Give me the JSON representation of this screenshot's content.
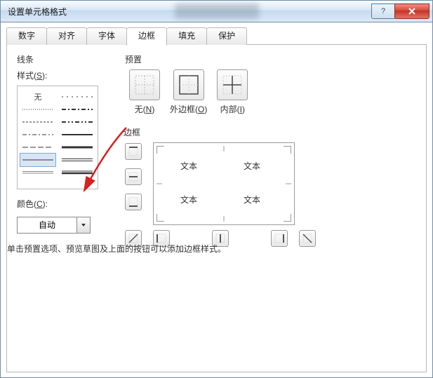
{
  "window": {
    "title": "设置单元格格式"
  },
  "tabs": [
    "数字",
    "对齐",
    "字体",
    "边框",
    "填充",
    "保护"
  ],
  "activeTab": 3,
  "line": {
    "section": "线条",
    "styleLabel": "样式(S):",
    "none": "无",
    "colorLabel": "颜色(C):",
    "colorValue": "自动"
  },
  "preset": {
    "section": "预置",
    "items": [
      {
        "id": "none",
        "label": "无(N)"
      },
      {
        "id": "outline",
        "label": "外边框(O)"
      },
      {
        "id": "inside",
        "label": "内部(I)"
      }
    ]
  },
  "border": {
    "section": "边框",
    "previewText": "文本"
  },
  "hint": "单击预置选项、预览草图及上面的按钮可以添加边框样式。"
}
